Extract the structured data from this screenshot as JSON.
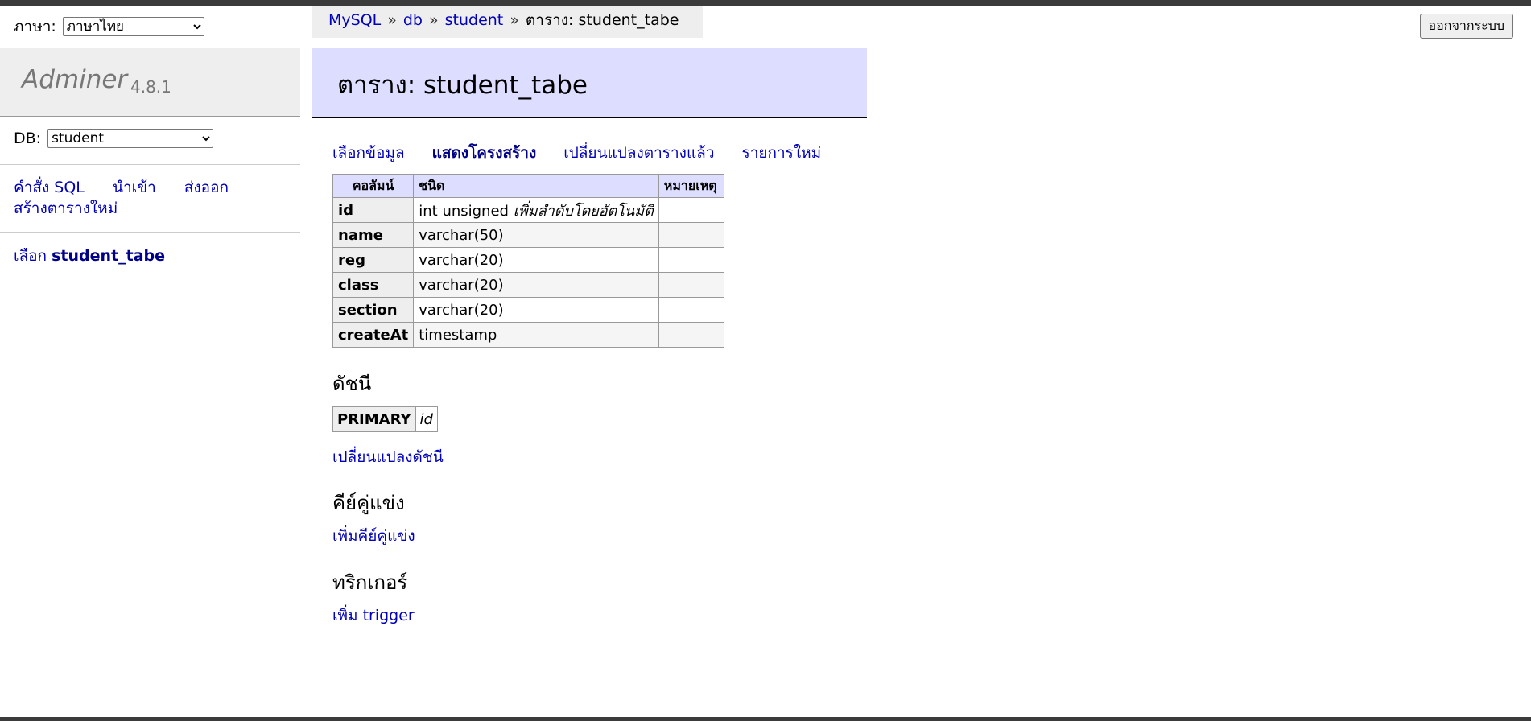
{
  "language": {
    "label": "ภาษา:",
    "selected": "ภาษาไทย"
  },
  "brand": {
    "name": "Adminer",
    "version": "4.8.1"
  },
  "db": {
    "label": "DB:",
    "selected": "student"
  },
  "menu_links": {
    "sql": "คำสั่ง SQL",
    "import": "นำเข้า",
    "export": "ส่งออก",
    "create_table": "สร้างตารางใหม่"
  },
  "table_link": {
    "select": "เลือก",
    "name": "student_tabe"
  },
  "breadcrumb": {
    "server": "MySQL",
    "sep": "»",
    "db": "db",
    "schema": "student",
    "current": "ตาราง: student_tabe"
  },
  "logout": "ออกจากระบบ",
  "title": "ตาราง: student_tabe",
  "tabs": [
    "เลือกข้อมูล",
    "แสดงโครงสร้าง",
    "เปลี่ยนแปลงตารางแล้ว",
    "รายการใหม่"
  ],
  "structure": {
    "headers": [
      "คอลัมน์",
      "ชนิด",
      "หมายเหตุ"
    ],
    "rows": [
      {
        "column": "id",
        "type": "int unsigned",
        "extra": "เพิ่มลำดับโดยอัตโนมัติ",
        "comment": ""
      },
      {
        "column": "name",
        "type": "varchar(50)",
        "extra": "",
        "comment": ""
      },
      {
        "column": "reg",
        "type": "varchar(20)",
        "extra": "",
        "comment": ""
      },
      {
        "column": "class",
        "type": "varchar(20)",
        "extra": "",
        "comment": ""
      },
      {
        "column": "section",
        "type": "varchar(20)",
        "extra": "",
        "comment": ""
      },
      {
        "column": "createAt",
        "type": "timestamp",
        "extra": "",
        "comment": ""
      }
    ]
  },
  "indexes": {
    "heading": "ดัชนี",
    "type": "PRIMARY",
    "columns": "id",
    "alter_link": "เปลี่ยนแปลงดัชนี"
  },
  "foreign_keys": {
    "heading": "คีย์คู่แข่ง",
    "add_link": "เพิ่มคีย์คู่แข่ง"
  },
  "triggers": {
    "heading": "ทริกเกอร์",
    "add_link": "เพิ่ม trigger"
  }
}
